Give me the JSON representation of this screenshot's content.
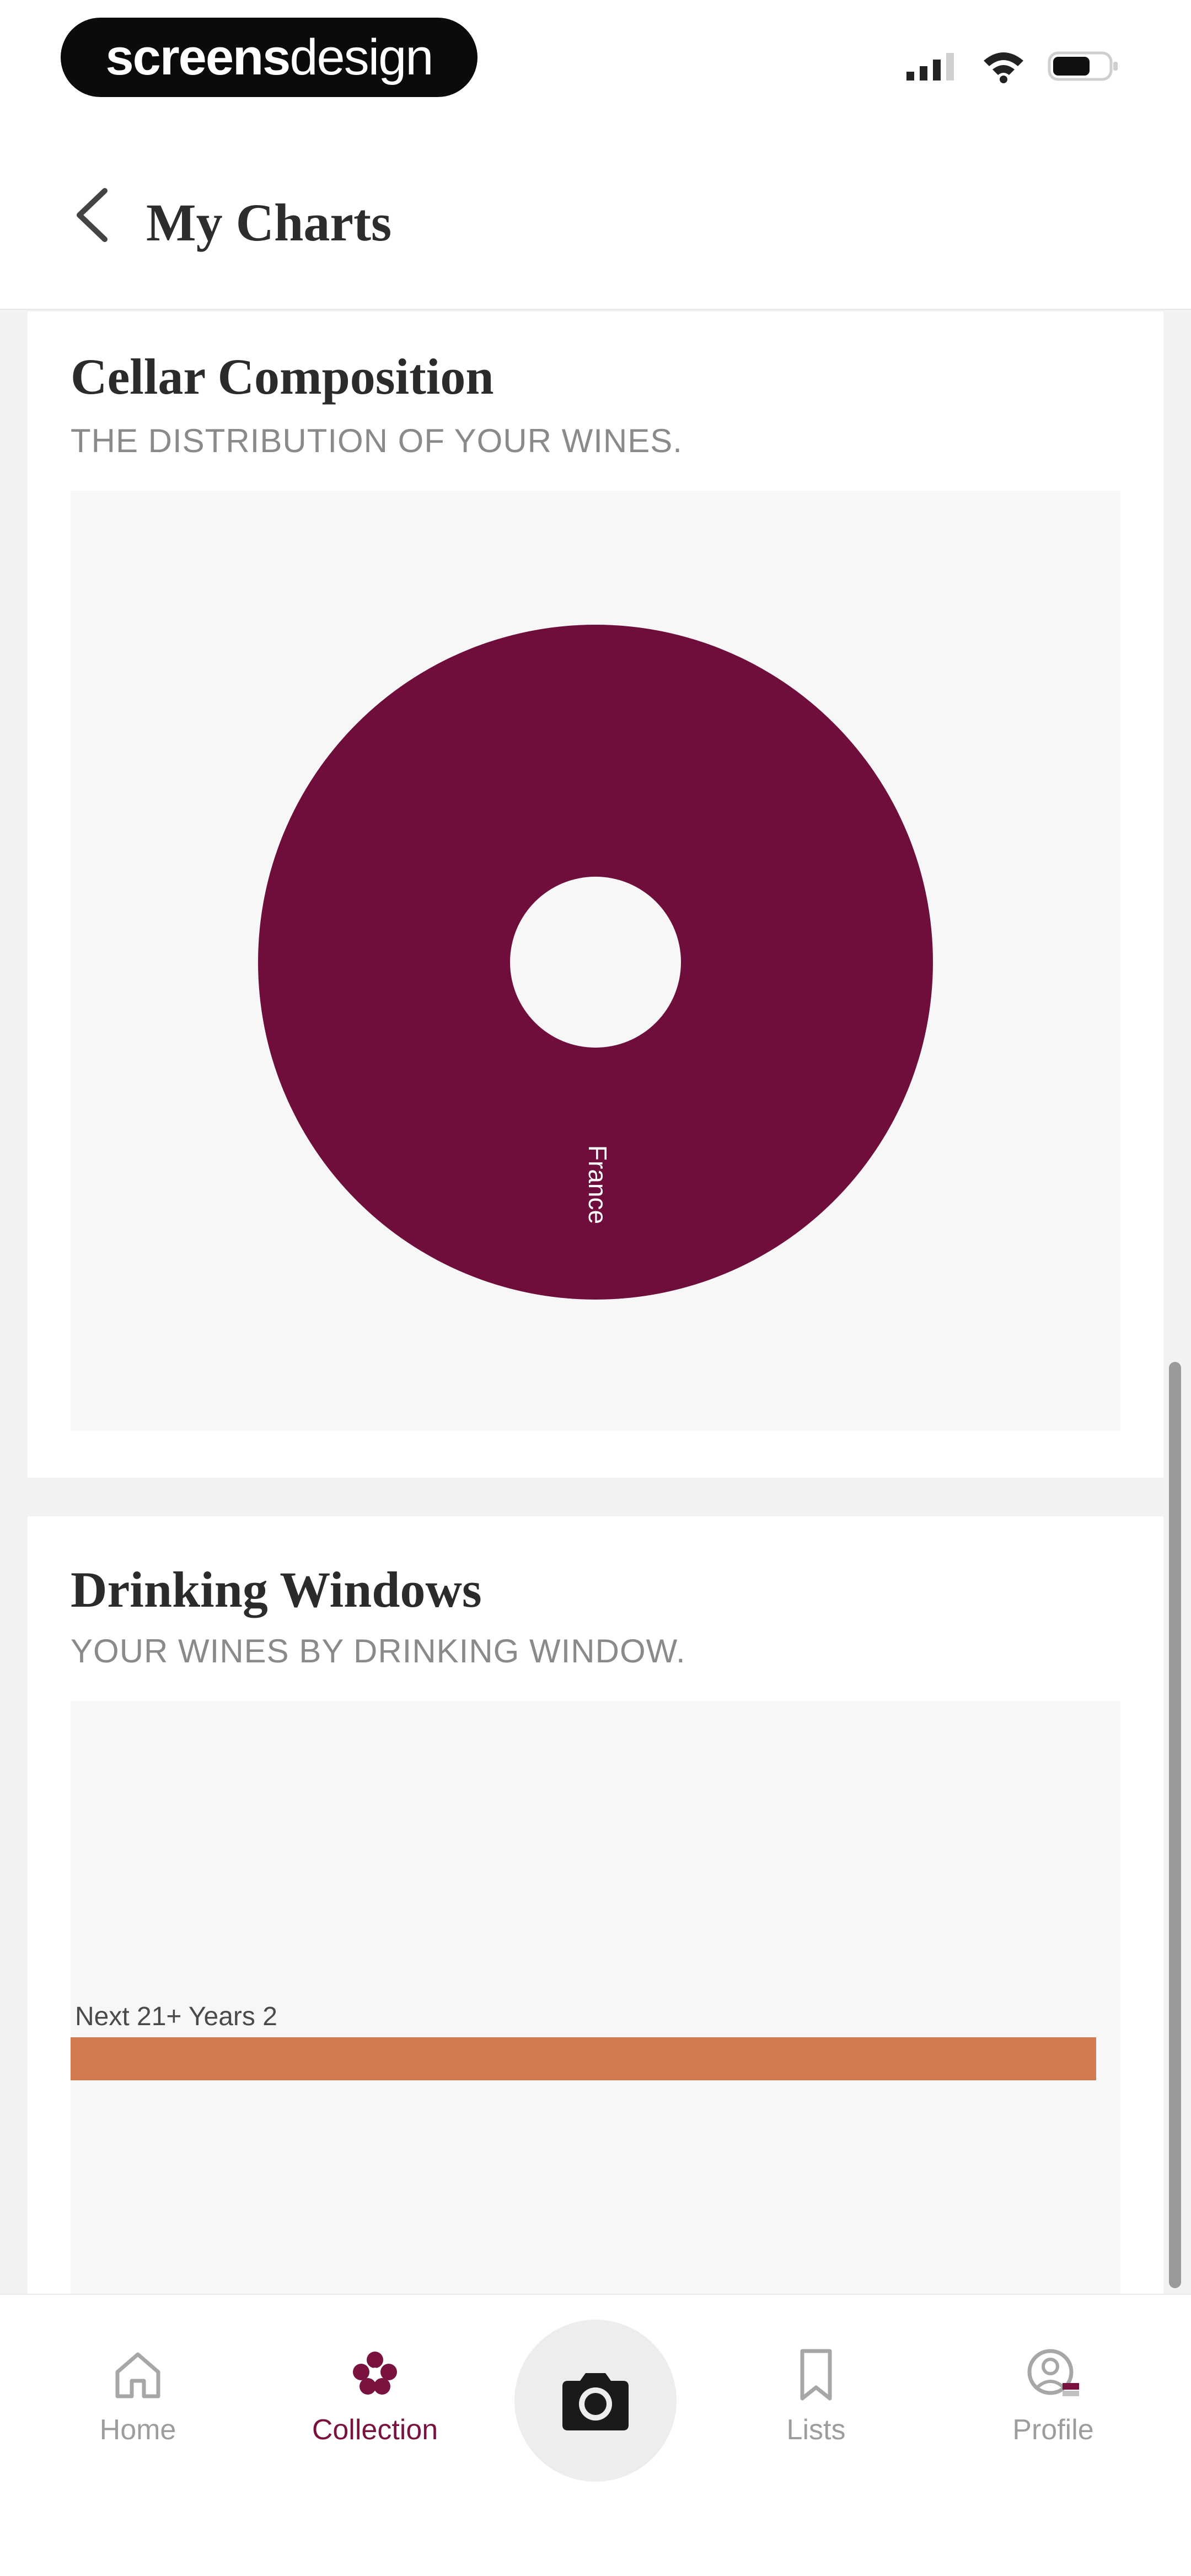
{
  "watermark": {
    "bold": "screens",
    "light": "design"
  },
  "header": {
    "title": "My Charts"
  },
  "colors": {
    "accent": "#6f0e3c",
    "bar": "#d17a4f",
    "chart_bg": "#f7f7f7"
  },
  "cellar_card": {
    "title": "Cellar Composition",
    "subtitle": "THE DISTRIBUTION OF YOUR WINES."
  },
  "drinking_card": {
    "title": "Drinking Windows",
    "subtitle": "YOUR WINES BY DRINKING WINDOW."
  },
  "chart_data": [
    {
      "type": "pie",
      "donut": true,
      "title": "Cellar Composition",
      "subtitle": "THE DISTRIBUTION OF YOUR WINES.",
      "categories": [
        "France"
      ],
      "values": [
        100
      ],
      "colors": [
        "#6f0e3c"
      ]
    },
    {
      "type": "bar",
      "orientation": "horizontal",
      "title": "Drinking Windows",
      "subtitle": "YOUR WINES BY DRINKING WINDOW.",
      "categories": [
        "Next 21+ Years"
      ],
      "values": [
        2
      ],
      "bar_labels": [
        "Next 21+ Years 2"
      ],
      "colors": [
        "#d17a4f"
      ]
    }
  ],
  "tab_bar": {
    "items": [
      {
        "label": "Home",
        "icon": "home-icon"
      },
      {
        "label": "Collection",
        "icon": "collection-icon",
        "active": true
      },
      {
        "label": "",
        "icon": "camera-icon"
      },
      {
        "label": "Lists",
        "icon": "bookmark-icon"
      },
      {
        "label": "Profile",
        "icon": "profile-icon"
      }
    ]
  }
}
